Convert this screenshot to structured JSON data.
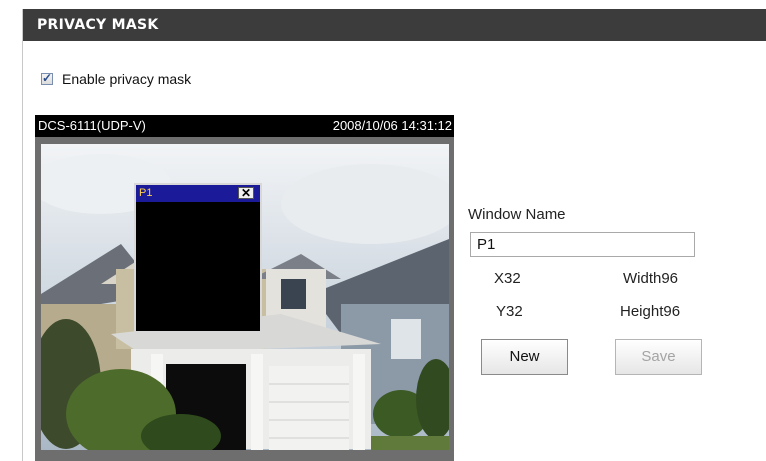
{
  "header": {
    "title": "PRIVACY MASK"
  },
  "enable": {
    "label": "Enable privacy mask",
    "checked": true
  },
  "camera": {
    "name": "DCS-6111(UDP-V)",
    "timestamp": "2008/10/06 14:31:12"
  },
  "mask": {
    "title": "P1",
    "close_symbol": "✕"
  },
  "window_name": {
    "label": "Window Name",
    "value": "P1"
  },
  "coords": {
    "x": "X32",
    "y": "Y32",
    "width": "Width96",
    "height": "Height96"
  },
  "buttons": {
    "new": "New",
    "save": "Save"
  }
}
